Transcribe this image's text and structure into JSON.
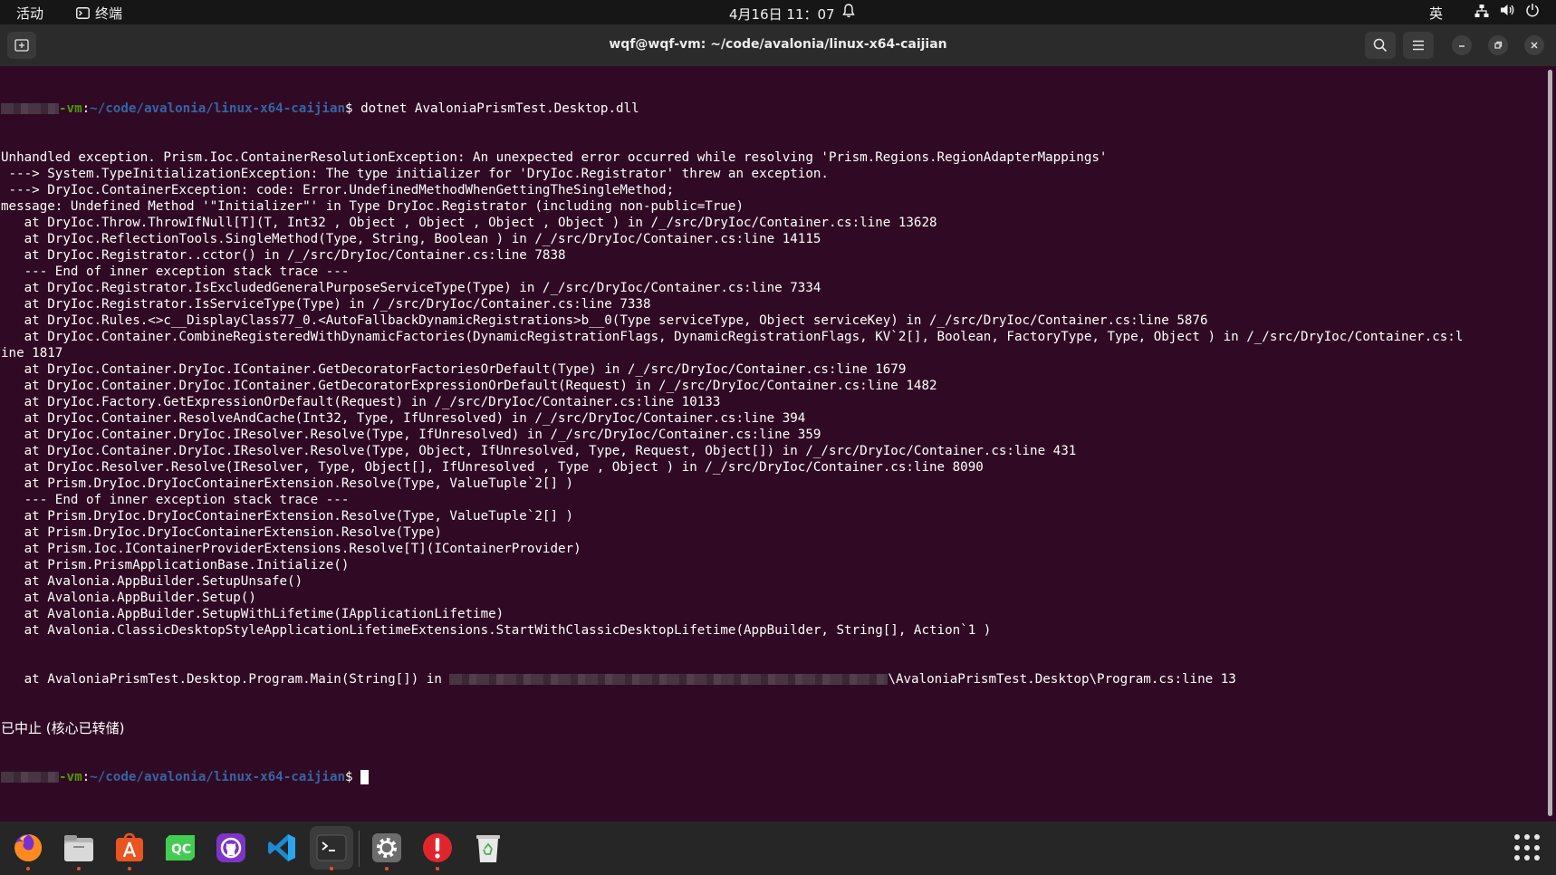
{
  "topbar": {
    "activities": "活动",
    "app_name": "终端",
    "clock": "4月16日  11：07",
    "input_lang": "英"
  },
  "window": {
    "title": "wqf@wqf-vm: ~/code/avalonia/linux-x64-caijian"
  },
  "terminal": {
    "prompt": {
      "host_suffix": "-vm",
      "path": "~/code/avalonia/linux-x64-caijian",
      "symbol": "$"
    },
    "command": " dotnet AvaloniaPrismTest.Desktop.dll",
    "output": [
      "Unhandled exception. Prism.Ioc.ContainerResolutionException: An unexpected error occurred while resolving 'Prism.Regions.RegionAdapterMappings'",
      " ---> System.TypeInitializationException: The type initializer for 'DryIoc.Registrator' threw an exception.",
      " ---> DryIoc.ContainerException: code: Error.UndefinedMethodWhenGettingTheSingleMethod;",
      "message: Undefined Method '\"Initializer\"' in Type DryIoc.Registrator (including non-public=True)",
      "   at DryIoc.Throw.ThrowIfNull[T](T, Int32 , Object , Object , Object , Object ) in /_/src/DryIoc/Container.cs:line 13628",
      "   at DryIoc.ReflectionTools.SingleMethod(Type, String, Boolean ) in /_/src/DryIoc/Container.cs:line 14115",
      "   at DryIoc.Registrator..cctor() in /_/src/DryIoc/Container.cs:line 7838",
      "   --- End of inner exception stack trace ---",
      "   at DryIoc.Registrator.IsExcludedGeneralPurposeServiceType(Type) in /_/src/DryIoc/Container.cs:line 7334",
      "   at DryIoc.Registrator.IsServiceType(Type) in /_/src/DryIoc/Container.cs:line 7338",
      "   at DryIoc.Rules.<>c__DisplayClass77_0.<AutoFallbackDynamicRegistrations>b__0(Type serviceType, Object serviceKey) in /_/src/DryIoc/Container.cs:line 5876",
      "   at DryIoc.Container.CombineRegisteredWithDynamicFactories(DynamicRegistrationFlags, DynamicRegistrationFlags, KV`2[], Boolean, FactoryType, Type, Object ) in /_/src/DryIoc/Container.cs:l",
      "ine 1817",
      "   at DryIoc.Container.DryIoc.IContainer.GetDecoratorFactoriesOrDefault(Type) in /_/src/DryIoc/Container.cs:line 1679",
      "   at DryIoc.Container.DryIoc.IContainer.GetDecoratorExpressionOrDefault(Request) in /_/src/DryIoc/Container.cs:line 1482",
      "   at DryIoc.Factory.GetExpressionOrDefault(Request) in /_/src/DryIoc/Container.cs:line 10133",
      "   at DryIoc.Container.ResolveAndCache(Int32, Type, IfUnresolved) in /_/src/DryIoc/Container.cs:line 394",
      "   at DryIoc.Container.DryIoc.IResolver.Resolve(Type, IfUnresolved) in /_/src/DryIoc/Container.cs:line 359",
      "   at DryIoc.Container.DryIoc.IResolver.Resolve(Type, Object, IfUnresolved, Type, Request, Object[]) in /_/src/DryIoc/Container.cs:line 431",
      "   at DryIoc.Resolver.Resolve(IResolver, Type, Object[], IfUnresolved , Type , Object ) in /_/src/DryIoc/Container.cs:line 8090",
      "   at Prism.DryIoc.DryIocContainerExtension.Resolve(Type, ValueTuple`2[] )",
      "   --- End of inner exception stack trace ---",
      "   at Prism.DryIoc.DryIocContainerExtension.Resolve(Type, ValueTuple`2[] )",
      "   at Prism.DryIoc.DryIocContainerExtension.Resolve(Type)",
      "   at Prism.Ioc.IContainerProviderExtensions.Resolve[T](IContainerProvider)",
      "   at Prism.PrismApplicationBase.Initialize()",
      "   at Avalonia.AppBuilder.SetupUnsafe()",
      "   at Avalonia.AppBuilder.Setup()",
      "   at Avalonia.AppBuilder.SetupWithLifetime(IApplicationLifetime)",
      "   at Avalonia.ClassicDesktopStyleApplicationLifetimeExtensions.StartWithClassicDesktopLifetime(AppBuilder, String[], Action`1 )"
    ],
    "main_line_prefix": "   at AvaloniaPrismTest.Desktop.Program.Main(String[]) in ",
    "main_line_suffix": "\\AvaloniaPrismTest.Desktop\\Program.cs:line 13",
    "aborted": "已中止 (核心已转储)"
  },
  "dock": {
    "items": [
      "firefox-icon",
      "files-icon",
      "app-center-icon",
      "qt-creator-icon",
      "github-desktop-icon",
      "vscode-icon",
      "terminal-icon",
      "settings-icon",
      "update-notifier-icon",
      "trash-icon"
    ]
  }
}
